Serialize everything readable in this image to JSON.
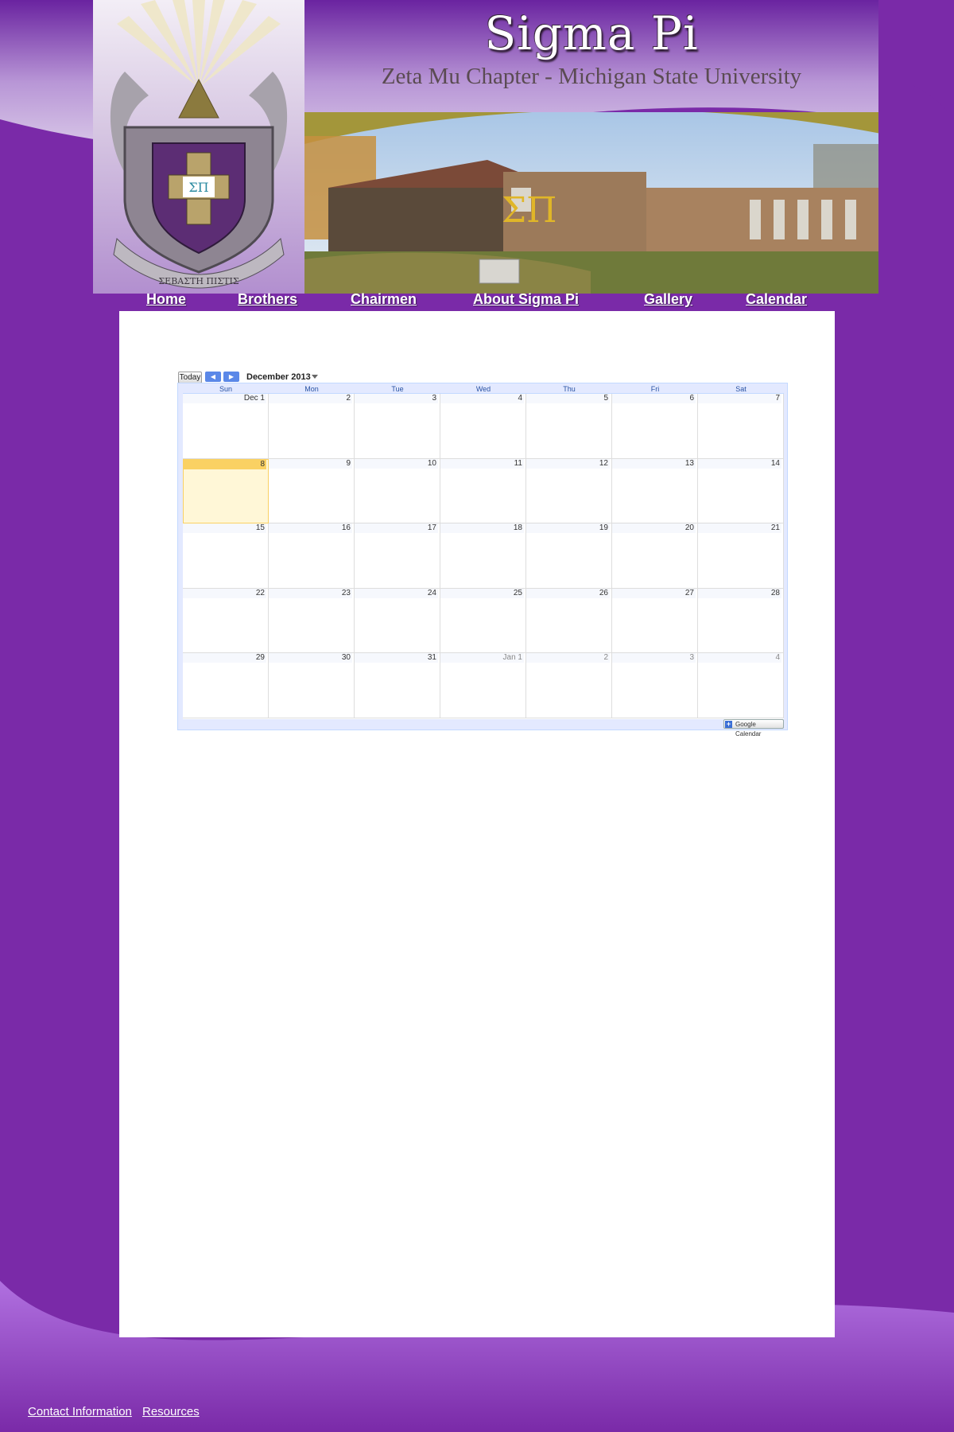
{
  "header": {
    "site_title": "Sigma Pi",
    "site_subtitle": "Zeta Mu Chapter - Michigan State University",
    "crest_motto": "ΣΕΒΑΣΤΗ ΠΙΣΤΙΣ",
    "crest_letters": "ΣΠ",
    "house_letters": "ΣΠ"
  },
  "nav": {
    "items": [
      {
        "label": "Home"
      },
      {
        "label": "Brothers"
      },
      {
        "label": "Chairmen"
      },
      {
        "label": "About Sigma Pi"
      },
      {
        "label": "Gallery"
      },
      {
        "label": "Calendar"
      }
    ]
  },
  "calendar": {
    "today_label": "Today",
    "prev_icon": "◀",
    "next_icon": "▶",
    "month_label": "December 2013",
    "weekdays": [
      "Sun",
      "Mon",
      "Tue",
      "Wed",
      "Thu",
      "Fri",
      "Sat"
    ],
    "weeks": [
      [
        {
          "d": "Dec 1"
        },
        {
          "d": "2"
        },
        {
          "d": "3"
        },
        {
          "d": "4"
        },
        {
          "d": "5"
        },
        {
          "d": "6"
        },
        {
          "d": "7"
        }
      ],
      [
        {
          "d": "8",
          "today": true
        },
        {
          "d": "9"
        },
        {
          "d": "10"
        },
        {
          "d": "11"
        },
        {
          "d": "12"
        },
        {
          "d": "13"
        },
        {
          "d": "14"
        }
      ],
      [
        {
          "d": "15"
        },
        {
          "d": "16"
        },
        {
          "d": "17"
        },
        {
          "d": "18"
        },
        {
          "d": "19"
        },
        {
          "d": "20"
        },
        {
          "d": "21"
        }
      ],
      [
        {
          "d": "22"
        },
        {
          "d": "23"
        },
        {
          "d": "24"
        },
        {
          "d": "25"
        },
        {
          "d": "26"
        },
        {
          "d": "27"
        },
        {
          "d": "28"
        }
      ],
      [
        {
          "d": "29"
        },
        {
          "d": "30"
        },
        {
          "d": "31"
        },
        {
          "d": "Jan 1",
          "other": true
        },
        {
          "d": "2",
          "other": true
        },
        {
          "d": "3",
          "other": true
        },
        {
          "d": "4",
          "other": true
        }
      ]
    ],
    "badge_plus": "+",
    "badge_label": "Google Calendar"
  },
  "footer": {
    "links": [
      {
        "label": "Contact Information"
      },
      {
        "label": "Resources"
      }
    ]
  },
  "colors": {
    "background": "#7a2aa8",
    "today_highlight": "#fad163",
    "weekday_text": "#2952a3"
  }
}
